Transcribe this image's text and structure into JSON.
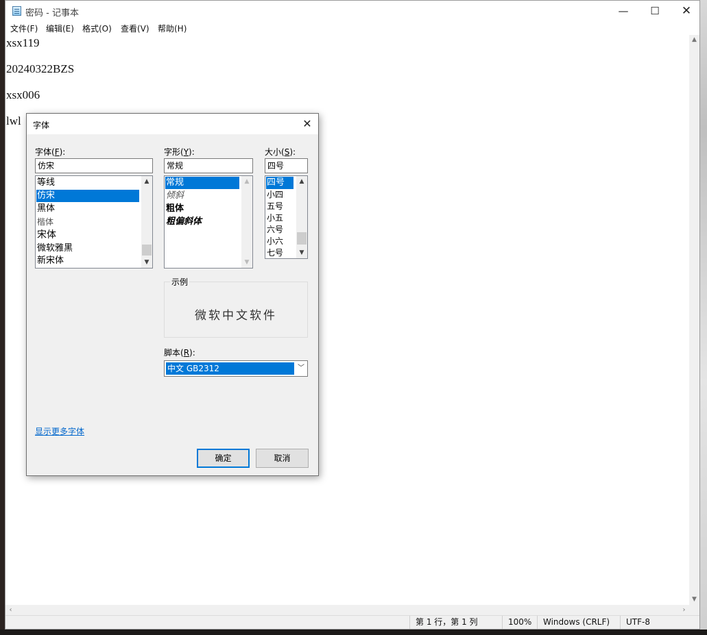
{
  "window": {
    "title": "密码 - 记事本",
    "controls": {
      "minimize": "—",
      "maximize": "☐",
      "close": "✕"
    }
  },
  "menu": [
    "文件(F)",
    "编辑(E)",
    "格式(O)",
    "查看(V)",
    "帮助(H)"
  ],
  "editor": {
    "lines": [
      "xsx119",
      "20240322BZS",
      "xsx006",
      "lwl"
    ]
  },
  "status": {
    "position": "第 1 行，第 1 列",
    "zoom": "100%",
    "line_ending": "Windows (CRLF)",
    "encoding": "UTF-8"
  },
  "dialog": {
    "title": "字体",
    "font": {
      "label": "字体",
      "mnemonic": "F",
      "value": "仿宋",
      "options": [
        "等线",
        "仿宋",
        "黑体",
        "楷体",
        "宋体",
        "微软雅黑",
        "新宋体"
      ],
      "selected": "仿宋"
    },
    "style": {
      "label": "字形",
      "mnemonic": "Y",
      "value": "常规",
      "options": [
        "常规",
        "倾斜",
        "粗体",
        "粗偏斜体"
      ],
      "selected": "常规"
    },
    "size": {
      "label": "大小",
      "mnemonic": "S",
      "value": "四号",
      "options": [
        "四号",
        "小四",
        "五号",
        "小五",
        "六号",
        "小六",
        "七号"
      ],
      "selected": "四号"
    },
    "sample": {
      "label": "示例",
      "text": "微软中文软件"
    },
    "script": {
      "label": "脚本",
      "mnemonic": "R",
      "value": "中文 GB2312"
    },
    "more_fonts_link": "显示更多字体",
    "ok": "确定",
    "cancel": "取消"
  },
  "colors": {
    "selection": "#0078d7",
    "link": "#0066cc"
  }
}
